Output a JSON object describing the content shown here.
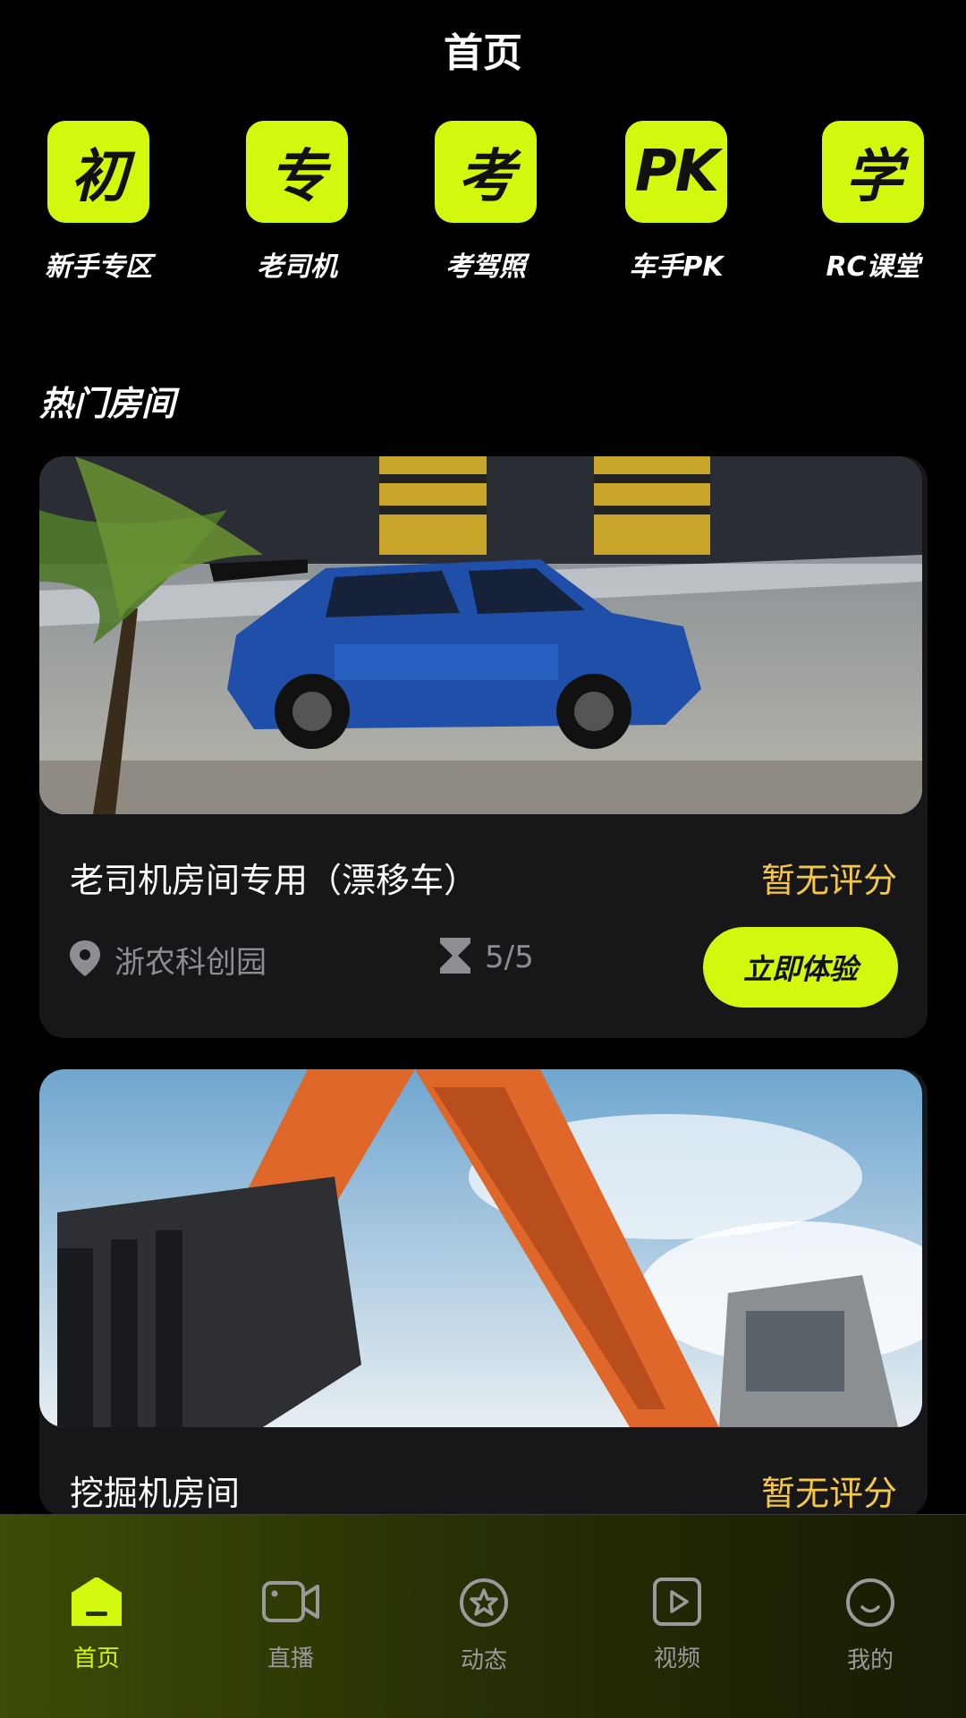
{
  "header": {
    "title": "首页"
  },
  "quick_actions": [
    {
      "glyph": "初",
      "label": "新手专区"
    },
    {
      "glyph": "专",
      "label": "老司机"
    },
    {
      "glyph": "考",
      "label": "考驾照"
    },
    {
      "glyph": "PK",
      "label": "车手PK"
    },
    {
      "glyph": "学",
      "label": "RC课堂"
    }
  ],
  "section": {
    "title": "热门房间"
  },
  "rooms": [
    {
      "name": "老司机房间专用（漂移车）",
      "rating": "暂无评分",
      "location": "浙农科创园",
      "capacity": "5/5",
      "cta": "立即体验",
      "image": "race-car-photo"
    },
    {
      "name": "挖掘机房间",
      "rating": "暂无评分",
      "image": "excavator-photo"
    }
  ],
  "tabbar": {
    "items": [
      {
        "label": "首页",
        "icon": "home-icon",
        "active": true
      },
      {
        "label": "直播",
        "icon": "video-camera-icon"
      },
      {
        "label": "动态",
        "icon": "star-circle-icon"
      },
      {
        "label": "视频",
        "icon": "play-icon"
      },
      {
        "label": "我的",
        "icon": "smile-icon"
      }
    ]
  },
  "colors": {
    "accent": "#d4f70e",
    "rating": "#f5c84a",
    "card_bg": "#17171a"
  }
}
